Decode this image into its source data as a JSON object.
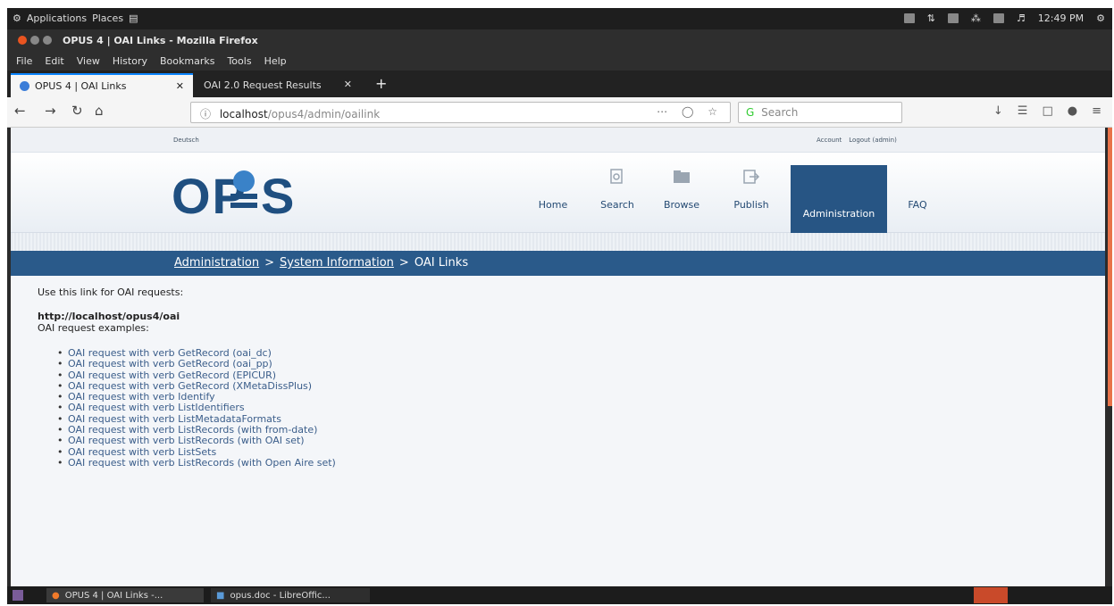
{
  "system": {
    "apps": "Applications",
    "places": "Places",
    "time": "12:49 PM"
  },
  "window": {
    "title": "OPUS 4 | OAI Links - Mozilla Firefox"
  },
  "menu": [
    "File",
    "Edit",
    "View",
    "History",
    "Bookmarks",
    "Tools",
    "Help"
  ],
  "tabs": [
    {
      "label": "OPUS 4 | OAI Links",
      "active": true
    },
    {
      "label": "OAI 2.0 Request Results",
      "active": false
    }
  ],
  "url": {
    "host": "localhost",
    "path": "/opus4/admin/oailink"
  },
  "search": {
    "placeholder": "Search"
  },
  "site": {
    "language": "Deutsch",
    "account": "Account",
    "logout": "Logout (admin)",
    "logo": "OPUS",
    "nav": [
      {
        "label": "Home",
        "icon": "home"
      },
      {
        "label": "Search",
        "icon": "search-icon"
      },
      {
        "label": "Browse",
        "icon": "folder-icon"
      },
      {
        "label": "Publish",
        "icon": "publish-icon"
      },
      {
        "label": "Administration",
        "icon": "admin",
        "active": true
      },
      {
        "label": "FAQ",
        "icon": "faq"
      }
    ]
  },
  "breadcrumb": {
    "level1": "Administration",
    "level2": "System Information",
    "current": "OAI Links"
  },
  "content": {
    "intro": "Use this link for OAI requests:",
    "oai_url": "http://localhost/opus4/oai",
    "examples_label": "OAI request examples:",
    "examples": [
      "OAI request with verb GetRecord (oai_dc)",
      "OAI request with verb GetRecord (oai_pp)",
      "OAI request with verb GetRecord (EPICUR)",
      "OAI request with verb GetRecord (XMetaDissPlus)",
      "OAI request with verb Identify",
      "OAI request with verb ListIdentifiers",
      "OAI request with verb ListMetadataFormats",
      "OAI request with verb ListRecords (with from-date)",
      "OAI request with verb ListRecords (with OAI set)",
      "OAI request with verb ListSets",
      "OAI request with verb ListRecords (with Open Aire set)"
    ]
  },
  "taskbar": {
    "firefox": "OPUS 4 | OAI Links -...",
    "libreoffice": "opus.doc - LibreOffic..."
  },
  "colors": {
    "brand_blue": "#275584",
    "breadcrumb_bg": "#2a5a8a",
    "link": "#3a5d8a",
    "accent_orange": "#e8734a"
  }
}
